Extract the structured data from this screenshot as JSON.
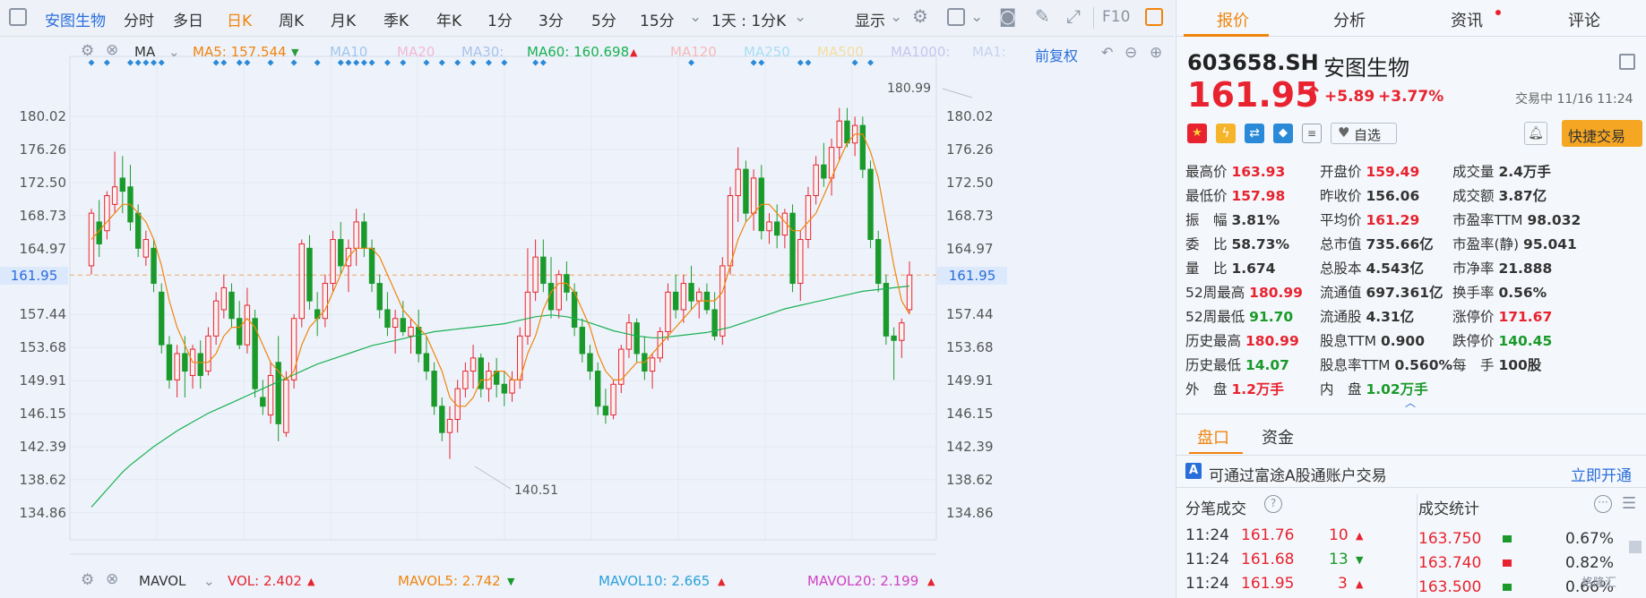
{
  "toolbar": {
    "stock_name": "安图生物",
    "items": [
      "分时",
      "多日",
      "日K",
      "周K",
      "月K",
      "季K",
      "年K",
      "1分",
      "3分",
      "5分",
      "15分",
      "1天 : 1分K"
    ],
    "display_label": "显示",
    "fq_label": "F10"
  },
  "chart": {
    "indicator_name": "MA",
    "ma_labels": [
      {
        "text": "MA5: 157.544",
        "color": "#f0840c",
        "arrow": "down"
      },
      {
        "text": "MA10",
        "color": "#9fc6ee"
      },
      {
        "text": "MA20",
        "color": "#f2b8d6"
      },
      {
        "text": "MA30:",
        "color": "#a8c2ea"
      },
      {
        "text": "MA60: 160.698",
        "color": "#1ab052",
        "arrow": "up"
      },
      {
        "text": "MA120",
        "color": "#f7b8b8"
      },
      {
        "text": "MA250",
        "color": "#a8dcf4"
      },
      {
        "text": "MA500",
        "color": "#f4dca0"
      },
      {
        "text": "MA1000:",
        "color": "#c8c4ee"
      },
      {
        "text": "MA1:",
        "color": "#c4d4ee"
      }
    ],
    "adjust_label": "前复权",
    "price_ticks": [
      "180.02",
      "176.26",
      "172.50",
      "168.73",
      "164.97",
      "161.95",
      "157.44",
      "153.68",
      "149.91",
      "146.15",
      "142.39",
      "138.62",
      "134.86"
    ],
    "current_price_marker": "161.95",
    "high_annotation": "180.99",
    "low_annotation": "140.51",
    "vol_indicator": "MAVOL",
    "vol_labels": [
      {
        "text": "VOL: 2.402",
        "color": "#e8232f"
      },
      {
        "text": "MAVOL5: 2.742",
        "color": "#f0840c"
      },
      {
        "text": "MAVOL10: 2.665",
        "color": "#2aa0d8"
      },
      {
        "text": "MAVOL20: 2.199",
        "color": "#d040c0"
      }
    ]
  },
  "chart_data": {
    "type": "candlestick",
    "title": "",
    "ylim": [
      133.0,
      183.5
    ],
    "ohlc": [
      [
        163.0,
        169.5,
        162.0,
        169.0
      ],
      [
        168.0,
        170.5,
        164.0,
        165.5
      ],
      [
        167.0,
        171.5,
        166.0,
        171.0
      ],
      [
        170.0,
        176.0,
        169.0,
        172.0
      ],
      [
        173.0,
        175.5,
        169.0,
        171.5
      ],
      [
        172.0,
        174.5,
        167.0,
        168.0
      ],
      [
        169.0,
        170.0,
        164.0,
        165.0
      ],
      [
        164.0,
        167.0,
        163.0,
        166.0
      ],
      [
        165.0,
        166.0,
        160.0,
        161.0
      ],
      [
        160.0,
        161.0,
        153.0,
        154.0
      ],
      [
        154.0,
        155.0,
        149.0,
        150.0
      ],
      [
        150.0,
        154.0,
        148.0,
        153.0
      ],
      [
        153.0,
        155.0,
        148.0,
        151.0
      ],
      [
        150.5,
        154.0,
        149.0,
        153.5
      ],
      [
        153.0,
        154.5,
        149.0,
        150.5
      ],
      [
        151.0,
        156.0,
        150.5,
        155.0
      ],
      [
        155.0,
        160.0,
        154.0,
        159.0
      ],
      [
        158.0,
        162.0,
        157.0,
        160.5
      ],
      [
        160.0,
        161.0,
        156.0,
        157.0
      ],
      [
        157.0,
        159.0,
        153.5,
        154.0
      ],
      [
        154.0,
        160.5,
        153.0,
        158.5
      ],
      [
        157.0,
        158.0,
        148.0,
        149.0
      ],
      [
        148.0,
        150.0,
        146.0,
        147.0
      ],
      [
        146.0,
        152.0,
        145.0,
        150.5
      ],
      [
        152.0,
        155.0,
        143.0,
        145.0
      ],
      [
        144.0,
        151.0,
        143.5,
        150.0
      ],
      [
        150.0,
        157.5,
        149.0,
        157.0
      ],
      [
        157.0,
        166.0,
        156.0,
        165.5
      ],
      [
        165.0,
        166.5,
        158.0,
        159.0
      ],
      [
        158.0,
        160.0,
        155.0,
        157.0
      ],
      [
        157.0,
        162.0,
        156.0,
        161.0
      ],
      [
        161.0,
        167.0,
        160.0,
        166.0
      ],
      [
        166.0,
        168.0,
        162.0,
        163.0
      ],
      [
        163.0,
        166.0,
        160.0,
        165.0
      ],
      [
        165.0,
        169.5,
        163.0,
        168.0
      ],
      [
        168.0,
        169.0,
        164.0,
        165.0
      ],
      [
        165.0,
        166.0,
        160.0,
        161.0
      ],
      [
        161.0,
        162.0,
        157.0,
        158.0
      ],
      [
        158.0,
        160.0,
        155.0,
        156.0
      ],
      [
        156.0,
        158.0,
        153.0,
        157.0
      ],
      [
        157.0,
        159.0,
        155.0,
        155.5
      ],
      [
        155.0,
        157.0,
        153.0,
        156.0
      ],
      [
        156.0,
        158.0,
        152.0,
        153.0
      ],
      [
        153.0,
        155.0,
        150.0,
        151.0
      ],
      [
        151.0,
        152.0,
        146.0,
        147.0
      ],
      [
        147.0,
        148.0,
        143.0,
        144.0
      ],
      [
        144.0,
        147.0,
        141.0,
        145.5
      ],
      [
        145.5,
        150.0,
        144.0,
        149.0
      ],
      [
        149.0,
        152.0,
        148.0,
        151.0
      ],
      [
        151.0,
        154.0,
        149.0,
        152.5
      ],
      [
        152.5,
        153.0,
        148.0,
        149.0
      ],
      [
        149.0,
        152.0,
        147.5,
        151.0
      ],
      [
        151.0,
        152.5,
        148.0,
        149.5
      ],
      [
        149.5,
        151.0,
        147.0,
        148.5
      ],
      [
        148.5,
        151.0,
        147.5,
        150.0
      ],
      [
        150.0,
        156.0,
        149.0,
        155.0
      ],
      [
        155.0,
        165.0,
        154.0,
        160.0
      ],
      [
        160.0,
        166.0,
        159.0,
        164.0
      ],
      [
        164.0,
        166.0,
        160.0,
        161.0
      ],
      [
        161.0,
        164.0,
        157.0,
        158.0
      ],
      [
        158.0,
        162.5,
        157.0,
        162.0
      ],
      [
        162.0,
        163.5,
        159.0,
        160.0
      ],
      [
        160.0,
        161.0,
        155.0,
        156.0
      ],
      [
        156.0,
        157.0,
        152.0,
        153.0
      ],
      [
        153.0,
        154.0,
        150.0,
        151.0
      ],
      [
        151.0,
        152.0,
        146.0,
        147.0
      ],
      [
        147.0,
        149.0,
        145.0,
        146.0
      ],
      [
        146.0,
        150.0,
        145.5,
        149.5
      ],
      [
        149.5,
        154.0,
        148.5,
        153.5
      ],
      [
        153.5,
        157.5,
        152.5,
        156.5
      ],
      [
        156.5,
        157.0,
        152.0,
        153.0
      ],
      [
        153.0,
        155.0,
        150.0,
        151.0
      ],
      [
        151.0,
        153.0,
        149.0,
        152.5
      ],
      [
        152.5,
        156.0,
        152.0,
        155.5
      ],
      [
        155.5,
        161.0,
        154.5,
        160.0
      ],
      [
        160.0,
        162.0,
        157.0,
        158.0
      ],
      [
        158.0,
        162.0,
        156.5,
        161.0
      ],
      [
        161.0,
        163.0,
        158.0,
        159.0
      ],
      [
        159.0,
        160.5,
        157.0,
        160.0
      ],
      [
        160.0,
        161.0,
        157.5,
        158.0
      ],
      [
        158.0,
        160.0,
        154.5,
        155.0
      ],
      [
        155.0,
        164.0,
        154.0,
        163.0
      ],
      [
        163.0,
        172.0,
        162.0,
        171.0
      ],
      [
        171.0,
        176.5,
        168.0,
        174.0
      ],
      [
        174.0,
        175.0,
        168.0,
        169.0
      ],
      [
        169.0,
        174.0,
        167.0,
        173.0
      ],
      [
        173.0,
        174.5,
        166.0,
        167.0
      ],
      [
        167.0,
        169.0,
        165.5,
        168.0
      ],
      [
        168.0,
        170.0,
        165.0,
        166.5
      ],
      [
        166.5,
        169.5,
        165.0,
        169.0
      ],
      [
        169.0,
        170.0,
        160.0,
        161.0
      ],
      [
        161.0,
        167.0,
        159.0,
        166.0
      ],
      [
        166.0,
        172.0,
        165.0,
        171.0
      ],
      [
        171.0,
        175.5,
        170.0,
        174.5
      ],
      [
        174.5,
        177.0,
        172.0,
        173.0
      ],
      [
        173.0,
        177.5,
        171.0,
        176.5
      ],
      [
        176.5,
        181.0,
        175.0,
        179.5
      ],
      [
        179.5,
        181.0,
        176.5,
        177.0
      ],
      [
        177.0,
        180.0,
        175.5,
        179.0
      ],
      [
        179.0,
        180.0,
        173.0,
        174.0
      ],
      [
        174.0,
        175.0,
        165.0,
        166.0
      ],
      [
        166.0,
        167.0,
        160.0,
        161.0
      ],
      [
        161.0,
        162.0,
        154.0,
        155.0
      ],
      [
        155.0,
        156.0,
        150.0,
        154.5
      ],
      [
        154.5,
        157.0,
        152.5,
        156.5
      ],
      [
        158.0,
        163.5,
        157.5,
        161.95
      ]
    ],
    "ma5": [
      166,
      167,
      168,
      169,
      170,
      170,
      169,
      168,
      166,
      163,
      159,
      156,
      154,
      152,
      152,
      152,
      153,
      155,
      156,
      156,
      157,
      156,
      154,
      152,
      151,
      150,
      151,
      154,
      156,
      157,
      158,
      160,
      162,
      164,
      165,
      165,
      165,
      164,
      162,
      160,
      158,
      157,
      156,
      155,
      153,
      151,
      148,
      147,
      147,
      148,
      150,
      150,
      151,
      151,
      150,
      150,
      153,
      155,
      158,
      160,
      161,
      161,
      160,
      158,
      156,
      153,
      151,
      150,
      150,
      151,
      152,
      152,
      153,
      154,
      155,
      156,
      157,
      158,
      159,
      159,
      159,
      160,
      163,
      166,
      168,
      169,
      170,
      170,
      169,
      168,
      167,
      167,
      168,
      169,
      171,
      173,
      175,
      177,
      178,
      178,
      176,
      173,
      168,
      163,
      159,
      157.5
    ],
    "ma60": [
      135.5,
      136.5,
      137.5,
      138.5,
      139.5,
      140.3,
      141.0,
      141.7,
      142.4,
      143.0,
      143.6,
      144.2,
      144.7,
      145.2,
      145.7,
      146.2,
      146.6,
      147.0,
      147.4,
      147.8,
      148.2,
      148.6,
      149.0,
      149.4,
      149.8,
      150.2,
      150.6,
      151.0,
      151.4,
      151.8,
      152.1,
      152.4,
      152.7,
      153.0,
      153.3,
      153.6,
      153.9,
      154.1,
      154.3,
      154.5,
      154.7,
      154.9,
      155.1,
      155.3,
      155.5,
      155.6,
      155.7,
      155.8,
      155.9,
      156.0,
      156.1,
      156.2,
      156.3,
      156.4,
      156.6,
      156.8,
      157.0,
      157.2,
      157.3,
      157.4,
      157.3,
      157.2,
      157.0,
      156.8,
      156.5,
      156.2,
      155.9,
      155.6,
      155.4,
      155.2,
      155.0,
      154.9,
      154.8,
      154.8,
      154.9,
      155.0,
      155.1,
      155.2,
      155.3,
      155.4,
      155.6,
      155.8,
      156.0,
      156.3,
      156.6,
      156.9,
      157.2,
      157.5,
      157.8,
      158.1,
      158.3,
      158.5,
      158.7,
      158.9,
      159.1,
      159.3,
      159.5,
      159.7,
      159.9,
      160.1,
      160.2,
      160.3,
      160.4,
      160.5,
      160.6,
      160.7
    ]
  },
  "quote": {
    "tabs": [
      "报价",
      "分析",
      "资讯",
      "评论"
    ],
    "code": "603658.SH",
    "name": "安图生物",
    "price": "161.95",
    "change": "+5.89",
    "change_pct": "+3.77%",
    "status": "交易中 11/16 11:24",
    "watch_label": "自选",
    "trade_button": "快捷交易",
    "fields": [
      [
        {
          "l": "最高价",
          "v": "163.93",
          "c": "red"
        },
        {
          "l": "开盘价",
          "v": "159.49",
          "c": "red"
        },
        {
          "l": "成交量",
          "v": "2.4万手",
          "c": "dark"
        }
      ],
      [
        {
          "l": "最低价",
          "v": "157.98",
          "c": "red"
        },
        {
          "l": "昨收价",
          "v": "156.06",
          "c": "dark"
        },
        {
          "l": "成交额",
          "v": "3.87亿",
          "c": "dark"
        }
      ],
      [
        {
          "l": "振　幅",
          "v": "3.81%",
          "c": "dark"
        },
        {
          "l": "平均价",
          "v": "161.29",
          "c": "red"
        },
        {
          "l": "市盈率TTM",
          "v": "98.032",
          "c": "dark"
        }
      ],
      [
        {
          "l": "委　比",
          "v": "58.73%",
          "c": "dark"
        },
        {
          "l": "总市值",
          "v": "735.66亿",
          "c": "dark"
        },
        {
          "l": "市盈率(静)",
          "v": "95.041",
          "c": "dark"
        }
      ],
      [
        {
          "l": "量　比",
          "v": "1.674",
          "c": "dark"
        },
        {
          "l": "总股本",
          "v": "4.543亿",
          "c": "dark"
        },
        {
          "l": "市净率",
          "v": "21.888",
          "c": "dark"
        }
      ],
      [
        {
          "l": "52周最高",
          "v": "180.99",
          "c": "red"
        },
        {
          "l": "流通值",
          "v": "697.361亿",
          "c": "dark"
        },
        {
          "l": "换手率",
          "v": "0.56%",
          "c": "dark"
        }
      ],
      [
        {
          "l": "52周最低",
          "v": "91.70",
          "c": "green"
        },
        {
          "l": "流通股",
          "v": "4.31亿",
          "c": "dark"
        },
        {
          "l": "涨停价",
          "v": "171.67",
          "c": "red"
        }
      ],
      [
        {
          "l": "历史最高",
          "v": "180.99",
          "c": "red"
        },
        {
          "l": "股息TTM",
          "v": "0.900",
          "c": "dark"
        },
        {
          "l": "跌停价",
          "v": "140.45",
          "c": "green"
        }
      ],
      [
        {
          "l": "历史最低",
          "v": "14.07",
          "c": "green"
        },
        {
          "l": "股息率TTM",
          "v": "0.560%",
          "c": "dark"
        },
        {
          "l": "每　手",
          "v": "100股",
          "c": "dark"
        }
      ],
      [
        {
          "l": "外　盘",
          "v": "1.2万手",
          "c": "red"
        },
        {
          "l": "内　盘",
          "v": "1.02万手",
          "c": "green"
        }
      ]
    ],
    "sub_tabs": [
      "盘口",
      "资金"
    ],
    "banner_text": "可通过富途A股通账户交易",
    "banner_link": "立即开通",
    "ticks_title": "分笔成交",
    "stats_title": "成交统计",
    "ticks": [
      {
        "time": "11:24",
        "price": "161.76",
        "vol": "10",
        "dir": "up"
      },
      {
        "time": "11:24",
        "price": "161.68",
        "vol": "13",
        "dir": "down"
      },
      {
        "time": "11:24",
        "price": "161.95",
        "vol": "3",
        "dir": "up"
      }
    ],
    "stats": [
      {
        "price": "163.750",
        "pct": "0.67%",
        "color": "#1a9a2b"
      },
      {
        "price": "163.740",
        "pct": "0.82%",
        "color": "#e8232f"
      },
      {
        "price": "163.500",
        "pct": "0.66%",
        "color": "#1a9a2b"
      }
    ],
    "watermark": "格隆汇"
  }
}
